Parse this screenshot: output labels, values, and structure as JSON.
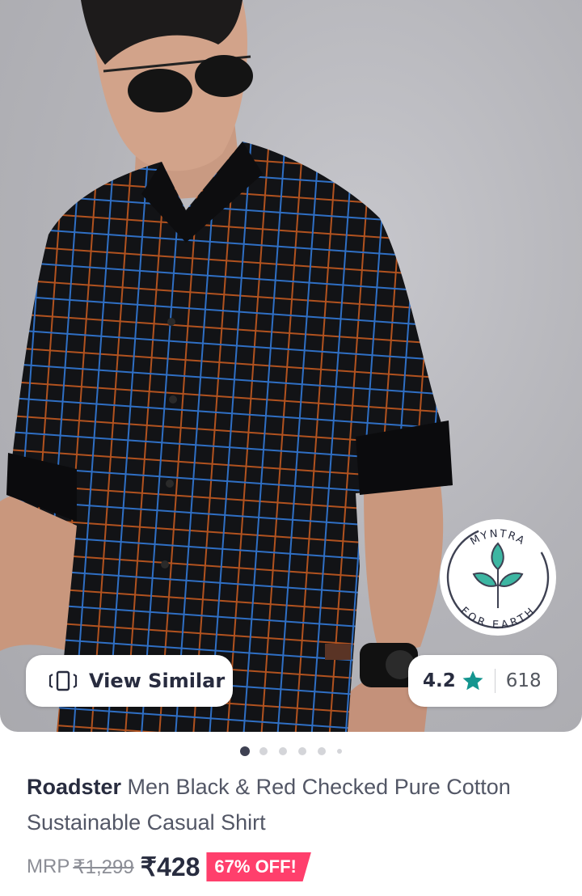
{
  "product_image": {
    "icon": "model-wearing-checked-shirt"
  },
  "sustainability_badge": {
    "top_text": "MYNTRA",
    "bottom_text": "FOR EARTH",
    "icon": "leaf-icon",
    "accent": "#3db6a2"
  },
  "view_similar": {
    "icon": "similar-icon",
    "label": "View Similar"
  },
  "rating": {
    "value": "4.2",
    "star_color": "#14958f",
    "count": "618"
  },
  "carousel": {
    "total": 6,
    "active_index": 0
  },
  "product": {
    "brand": "Roadster",
    "name": " Men Black & Red Checked Pure Cotton Sustainable Casual Shirt"
  },
  "price": {
    "mrp_label": "MRP",
    "original": "₹1,299",
    "current": "₹428",
    "discount": "67% OFF!",
    "discount_color": "#ff3f6c"
  }
}
